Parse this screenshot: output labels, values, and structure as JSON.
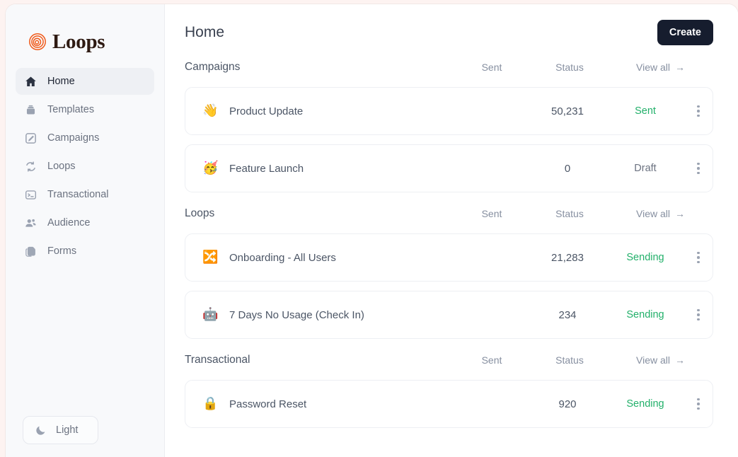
{
  "brand": {
    "name": "Loops",
    "mark": "loops-spiral-logo",
    "accent": "#f05a1a"
  },
  "sidebar": {
    "items": [
      {
        "label": "Home",
        "icon": "home-icon",
        "active": true
      },
      {
        "label": "Templates",
        "icon": "templates-icon",
        "active": false
      },
      {
        "label": "Campaigns",
        "icon": "campaigns-pencil-icon",
        "active": false
      },
      {
        "label": "Loops",
        "icon": "loops-refresh-icon",
        "active": false
      },
      {
        "label": "Transactional",
        "icon": "terminal-icon",
        "active": false
      },
      {
        "label": "Audience",
        "icon": "people-icon",
        "active": false
      },
      {
        "label": "Forms",
        "icon": "forms-copy-icon",
        "active": false
      }
    ],
    "theme_toggle": {
      "label": "Light",
      "icon": "moon-icon"
    }
  },
  "header": {
    "title": "Home",
    "create_label": "Create"
  },
  "columns": {
    "sent": "Sent",
    "status": "Status",
    "view_all": "View all",
    "view_all_arrow": "→"
  },
  "sections": [
    {
      "title": "Campaigns",
      "rows": [
        {
          "emoji": "👋",
          "emoji_name": "waving-hand-emoji",
          "name": "Product Update",
          "sent": "50,231",
          "status": "Sent",
          "status_kind": "sent"
        },
        {
          "emoji": "🥳",
          "emoji_name": "party-face-emoji",
          "name": "Feature Launch",
          "sent": "0",
          "status": "Draft",
          "status_kind": "draft"
        }
      ]
    },
    {
      "title": "Loops",
      "rows": [
        {
          "emoji": "🔀",
          "emoji_name": "shuffle-arrows-emoji",
          "name": "Onboarding - All Users",
          "sent": "21,283",
          "status": "Sending",
          "status_kind": "sending"
        },
        {
          "emoji": "🤖",
          "emoji_name": "robot-emoji",
          "name": "7 Days No Usage (Check In)",
          "sent": "234",
          "status": "Sending",
          "status_kind": "sending"
        }
      ]
    },
    {
      "title": "Transactional",
      "rows": [
        {
          "emoji": "🔒",
          "emoji_name": "lock-emoji",
          "name": "Password Reset",
          "sent": "920",
          "status": "Sending",
          "status_kind": "sending"
        }
      ]
    }
  ],
  "colors": {
    "status_green": "#22b06a",
    "button_dark": "#161d2e",
    "page_outer": "#fdf3f1"
  }
}
